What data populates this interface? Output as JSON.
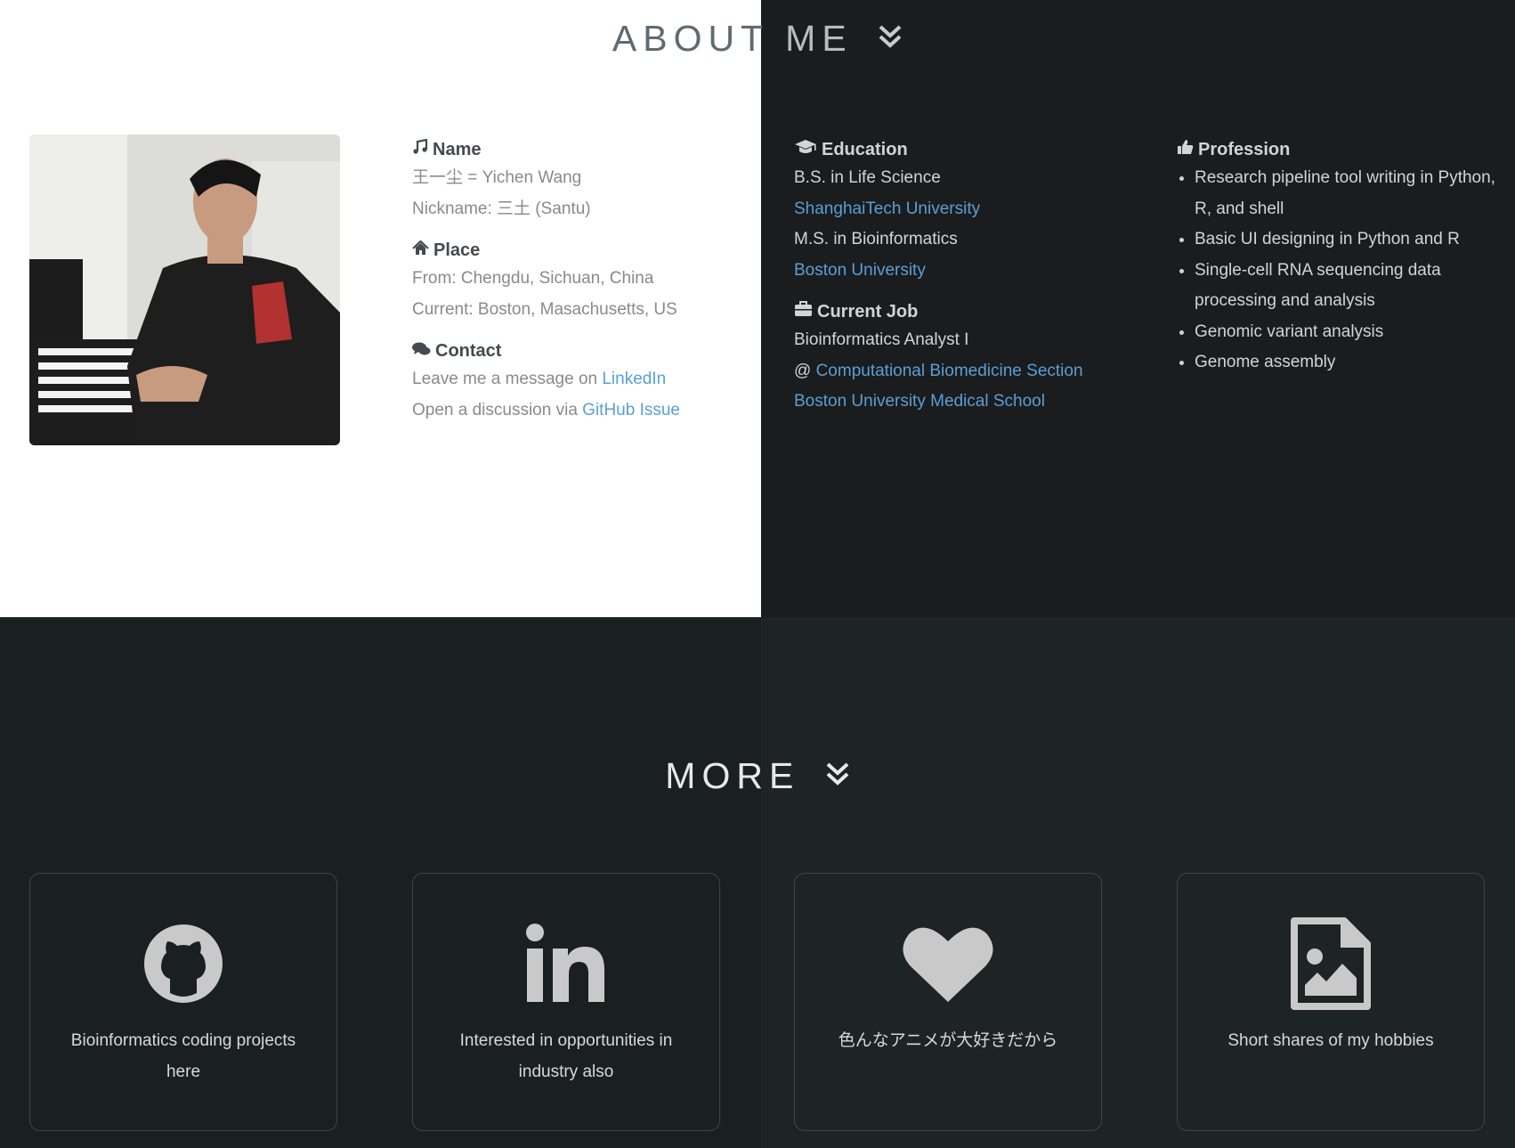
{
  "about": {
    "title_part1": "ABOUT",
    "title_part2": "ME",
    "name": {
      "heading": "Name",
      "line1": "王一尘 = Yichen Wang",
      "line2": "Nickname: 三土 (Santu)"
    },
    "place": {
      "heading": "Place",
      "from": "From: Chengdu, Sichuan, China",
      "current": "Current: Boston, Masachusetts, US"
    },
    "contact": {
      "heading": "Contact",
      "line1_prefix": "Leave me a message on ",
      "line1_link": "LinkedIn",
      "line2_prefix": "Open a discussion via ",
      "line2_link": "GitHub Issue"
    },
    "education": {
      "heading": "Education",
      "degree1": "B.S. in Life Science",
      "school1": "ShanghaiTech University",
      "degree2": "M.S. in Bioinformatics",
      "school2": "Boston University"
    },
    "job": {
      "heading": "Current Job",
      "title": "Bioinformatics Analyst I",
      "at": "@ ",
      "section": "Computational Biomedicine Section",
      "school": "Boston University Medical School"
    },
    "profession": {
      "heading": "Profession",
      "items": [
        "Research pipeline tool writing in Python, R, and shell",
        "Basic UI designing in Python and R",
        "Single-cell RNA sequencing data processing and analysis",
        "Genomic variant analysis",
        "Genome assembly"
      ]
    }
  },
  "more": {
    "title": "MORE",
    "cards": [
      {
        "icon": "github-icon",
        "text": "Bioinformatics coding projects here"
      },
      {
        "icon": "linkedin-icon",
        "text": "Interested in opportunities in industry also"
      },
      {
        "icon": "heart-icon",
        "text": "色んなアニメが大好きだから"
      },
      {
        "icon": "image-file-icon",
        "text": "Short shares of my hobbies"
      }
    ]
  },
  "colors": {
    "link": "#5a9fd6",
    "white_panel": "#ffffff",
    "dark_panel": "#1b1c1e",
    "footer_panel": "#1a1f22"
  }
}
